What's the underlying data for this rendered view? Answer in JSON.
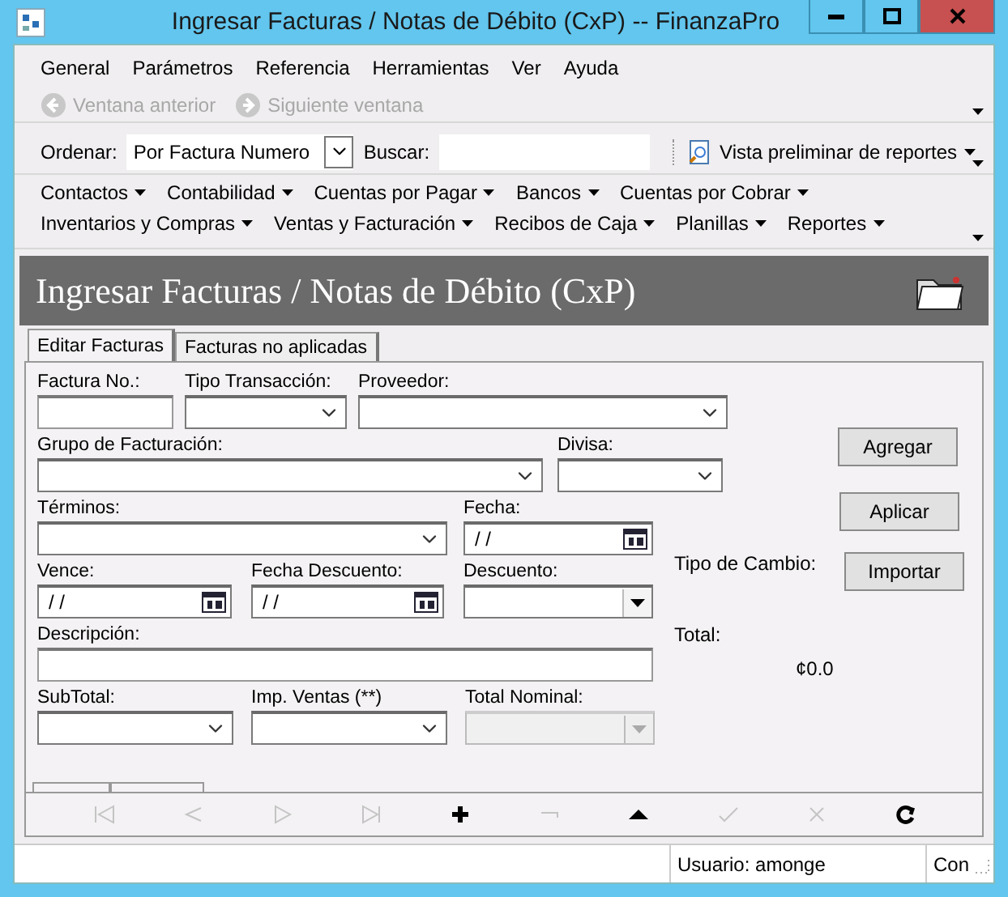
{
  "window": {
    "title": "Ingresar Facturas / Notas de Débito (CxP) -- FinanzaPro"
  },
  "menu": [
    "General",
    "Parámetros",
    "Referencia",
    "Herramientas",
    "Ver",
    "Ayuda"
  ],
  "nav_toolbar": [
    {
      "label": "Ventana anterior",
      "kind": "back",
      "disabled": true
    },
    {
      "label": "Siguiente ventana",
      "kind": "forward",
      "disabled": true
    }
  ],
  "sort_toolbar": {
    "sort_label": "Ordenar:",
    "sort_value": "Por Factura Numero",
    "search_label": "Buscar:",
    "report_button": "Vista preliminar de reportes"
  },
  "module_menu": [
    [
      "Contactos",
      "Contabilidad",
      "Cuentas por Pagar",
      "Bancos",
      "Cuentas por Cobrar"
    ],
    [
      "Inventarios y Compras",
      "Ventas y Facturación",
      "Recibos de Caja",
      "Planillas",
      "Reportes"
    ]
  ],
  "header": {
    "title": "Ingresar Facturas / Notas de Débito (CxP)"
  },
  "tabs": [
    {
      "label": "Editar Facturas",
      "selected": true
    },
    {
      "label": "Facturas no aplicadas",
      "selected": false
    }
  ],
  "form": [
    [
      {
        "label": "Factura No.:",
        "kind": "text",
        "disabled": false
      },
      {
        "label": "Tipo Transacción:",
        "kind": "combo",
        "disabled": false
      },
      {
        "label": "Proveedor:",
        "kind": "combo",
        "disabled": false
      }
    ],
    [
      {
        "label": "Grupo de Facturación:",
        "kind": "combo",
        "disabled": false
      },
      {
        "label": "Divisa:",
        "kind": "combo",
        "disabled": false
      }
    ],
    [
      {
        "label": "Términos:",
        "kind": "combo",
        "disabled": false
      },
      {
        "label": "Fecha:",
        "kind": "date",
        "value": "/ /",
        "disabled": false
      }
    ],
    [
      {
        "label": "Vence:",
        "kind": "date",
        "value": "/ /",
        "disabled": false
      },
      {
        "label": "Fecha Descuento:",
        "kind": "date",
        "value": "/ /",
        "disabled": false
      },
      {
        "label": "Descuento:",
        "kind": "dropdown",
        "disabled": false
      }
    ],
    [
      {
        "label": "Descripción:",
        "kind": "text",
        "disabled": false
      }
    ],
    [
      {
        "label": "SubTotal:",
        "kind": "combo",
        "disabled": false
      },
      {
        "label": "Imp. Ventas (**)",
        "kind": "combo",
        "disabled": false
      },
      {
        "label": "Total Nominal:",
        "kind": "dropdown",
        "disabled": true
      }
    ]
  ],
  "side": {
    "buttons": [
      "Agregar",
      "Aplicar",
      "Importar"
    ],
    "exchange_label": "Tipo de Cambio:",
    "total_label": "Total:",
    "total_value": "¢0.0"
  },
  "navigator": [
    {
      "kind": "first",
      "disabled": true
    },
    {
      "kind": "prev",
      "disabled": true
    },
    {
      "kind": "next",
      "disabled": true
    },
    {
      "kind": "last",
      "disabled": true
    },
    {
      "kind": "add",
      "disabled": false
    },
    {
      "kind": "remove",
      "disabled": true
    },
    {
      "kind": "up",
      "disabled": false
    },
    {
      "kind": "check",
      "disabled": true
    },
    {
      "kind": "cancel",
      "disabled": true
    },
    {
      "kind": "refresh",
      "disabled": false
    }
  ],
  "status_bar": {
    "user": "Usuario: amonge",
    "connection": "Con"
  }
}
